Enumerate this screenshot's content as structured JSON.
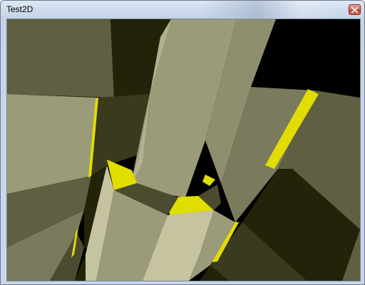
{
  "window": {
    "title": "Test2D",
    "close_icon": "close-icon"
  },
  "scene": {
    "description_colors": {
      "sky": "#000000",
      "yellow_highlight": "#e2dd00",
      "dark_olive": "#23230a",
      "mid_olive": "#5f5f42",
      "light_olive": "#9b9b7a",
      "pale_olive": "#c6c4a0"
    }
  }
}
